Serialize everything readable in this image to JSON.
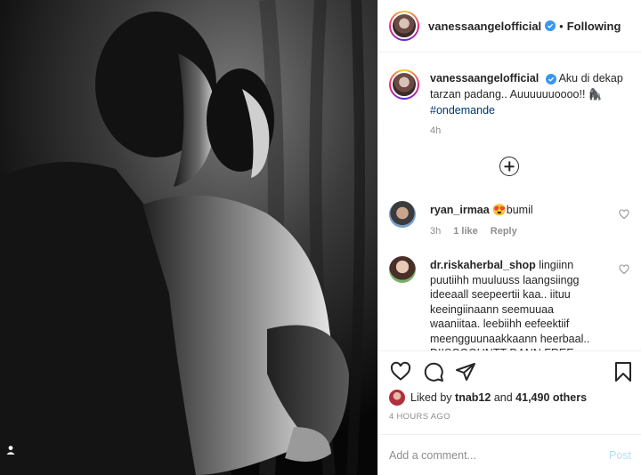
{
  "post": {
    "author": "vanessaangelofficial",
    "follow_dot": "•",
    "follow_status": "Following",
    "verified_icon": "verified-badge-icon"
  },
  "caption": {
    "username": "vanessaangelofficial",
    "text": "Aku di dekap tarzan padang.. Auuuuuuoooo!! 🦍",
    "hashtag": "#ondemande",
    "time": "4h"
  },
  "comments": [
    {
      "username": "ryan_irmaa",
      "text": "😍bumil",
      "time": "3h",
      "likes": "1 like",
      "reply": "Reply"
    },
    {
      "username": "dr.riskaherbal_shop",
      "text": "lingiinn puutiihh muuluuss laangsiingg ideeaall seepeertii kaa.. iituu keeingiinaann seemuuaa waaniitaa. leebiihh eefeektiif meengguunaakkaann heerbaal.. DIISCOOUNTT DANN FREE"
    }
  ],
  "actions": {
    "liked_by_prefix": "Liked by",
    "liked_by_user": "tnab12",
    "liked_by_and": "and",
    "liked_by_count": "41,490 others",
    "post_time": "4 HOURS AGO"
  },
  "add_comment": {
    "placeholder": "Add a comment...",
    "post_label": "Post"
  },
  "colors": {
    "link": "#00376b",
    "muted": "#8e8e8e",
    "post_disabled": "#b2dffc",
    "verified": "#3897f0"
  }
}
